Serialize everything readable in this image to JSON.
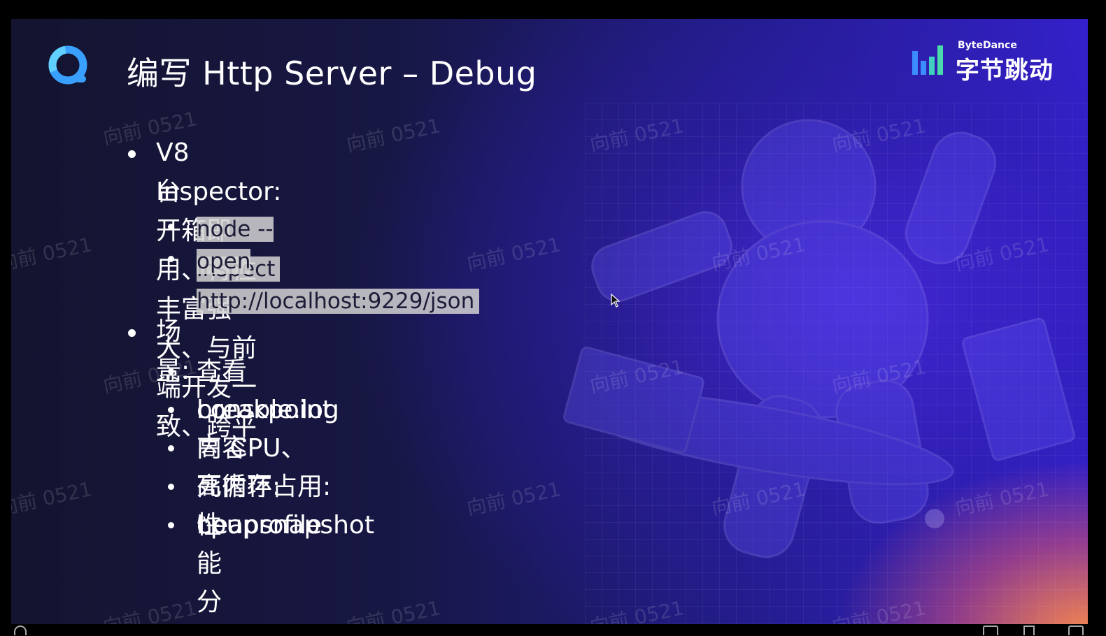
{
  "slide": {
    "title": "编写 Http Server – Debug",
    "brand": {
      "latin": "ByteDance",
      "chinese": "字节跳动"
    },
    "bullets": [
      {
        "text_line1": "V8 Inspector: 开箱即用、特性丰富强大、与前端开发一致、跨平",
        "text_line2": "台",
        "children": [
          "node --inspect",
          "open http://localhost:9229/json"
        ]
      },
      {
        "text_line1": "场景:",
        "children": [
          "查看 console.log 内容",
          "breakpoint",
          "高 CPU、死循环: cpuprofile",
          "高内存占用: heapsnapshot",
          "性能分析"
        ]
      }
    ]
  },
  "watermark": "向前 0521",
  "colors": {
    "text": "#ffffff",
    "highlight": "#d2d2d2",
    "logo_blue": "#3aa0ff",
    "accent_orange": "#ff8c46"
  },
  "icons": [
    "app-logo-icon",
    "bytedance-bars-icon",
    "mouse-cursor-icon"
  ]
}
